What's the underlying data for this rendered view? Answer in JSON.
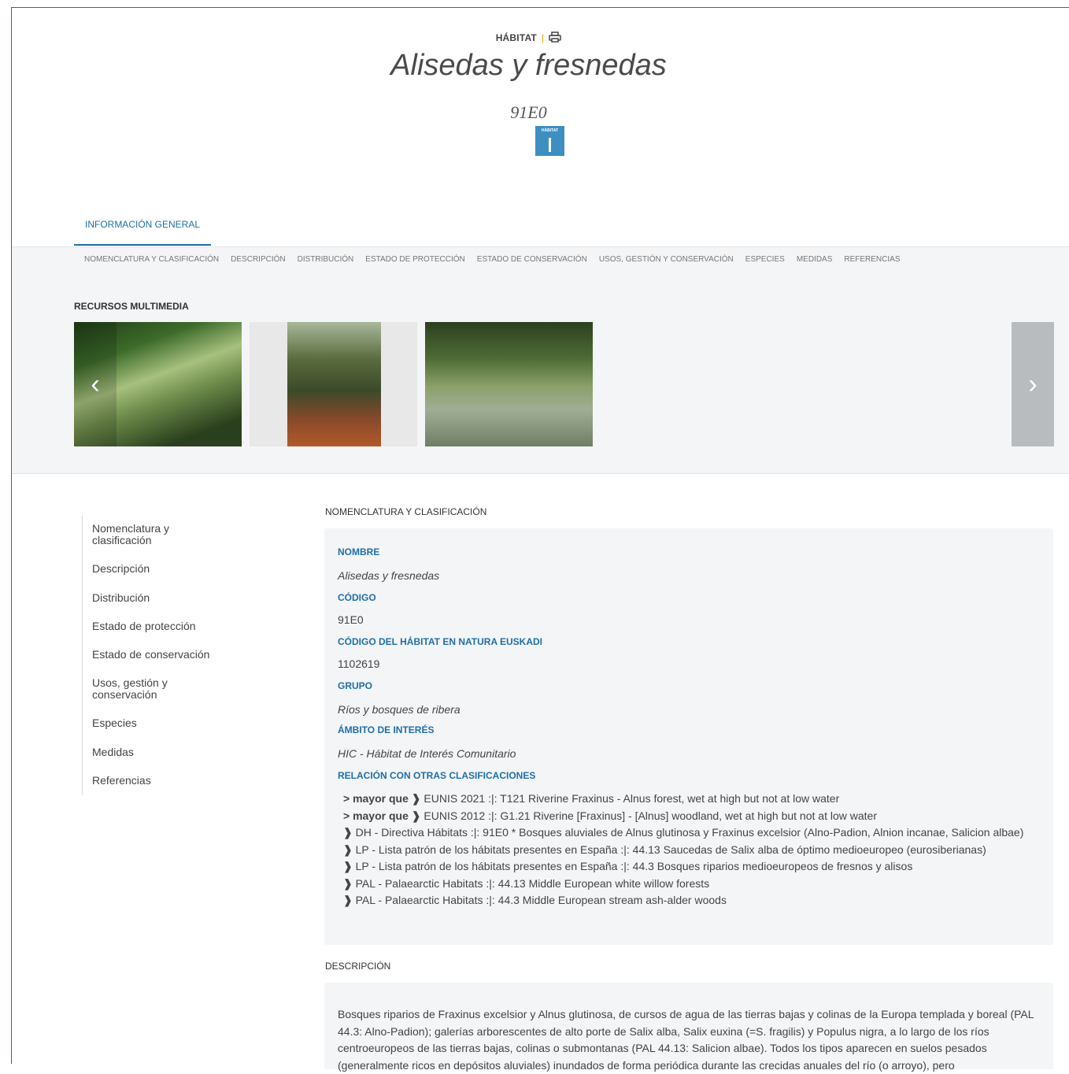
{
  "header": {
    "type_label": "HÁBITAT",
    "title": "Alisedas y fresnedas",
    "code": "91E0",
    "badge_label": "HÁBITAT"
  },
  "tabs": {
    "active": "INFORMACIÓN GENERAL"
  },
  "subnav": [
    "NOMENCLATURA Y CLASIFICACIÓN",
    "DESCRIPCIÓN",
    "DISTRIBUCIÓN",
    "ESTADO DE PROTECCIÓN",
    "ESTADO DE CONSERVACIÓN",
    "USOS, GESTIÓN Y CONSERVACIÓN",
    "ESPECIES",
    "MEDIDAS",
    "REFERENCIAS"
  ],
  "media": {
    "title": "RECURSOS MULTIMEDIA",
    "prev": "‹",
    "next": "›"
  },
  "sidenav": [
    "Nomenclatura y clasificación",
    "Descripción",
    "Distribución",
    "Estado de protección",
    "Estado de conservación",
    "Usos, gestión y conservación",
    "Especies",
    "Medidas",
    "Referencias"
  ],
  "nomenclatura": {
    "title": "NOMENCLATURA Y CLASIFICACIÓN",
    "nombre_label": "NOMBRE",
    "nombre": "Alisedas y fresnedas",
    "codigo_label": "CÓDIGO",
    "codigo": "91E0",
    "codigo_euskadi_label": "CÓDIGO DEL HÁBITAT EN NATURA EUSKADI",
    "codigo_euskadi": "1102619",
    "grupo_label": "GRUPO",
    "grupo": "Ríos y bosques de ribera",
    "ambito_label": "ÁMBITO DE INTERÉS",
    "ambito": "HIC - Hábitat de Interés Comunitario",
    "relacion_label": "RELACIÓN CON OTRAS CLASIFICACIONES",
    "relaciones": [
      {
        "prefix": "> mayor que ❱",
        "text": " EUNIS 2021 :|: T121 Riverine Fraxinus - Alnus forest, wet at high but not at low water"
      },
      {
        "prefix": "> mayor que ❱",
        "text": " EUNIS 2012 :|: G1.21 Riverine [Fraxinus] - [Alnus] woodland, wet at high but not at low water"
      },
      {
        "prefix": "❱",
        "text": " DH - Directiva Hábitats :|: 91E0 * Bosques aluviales de Alnus glutinosa y Fraxinus excelsior (Alno-Padion, Alnion incanae, Salicion albae)"
      },
      {
        "prefix": "❱",
        "text": " LP - Lista patrón de los hábitats presentes en España :|: 44.13 Saucedas de Salix alba de óptimo medioeuropeo (eurosiberianas)"
      },
      {
        "prefix": "❱",
        "text": " LP - Lista patrón de los hábitats presentes en España :|: 44.3 Bosques riparios medioeuropeos de fresnos y alisos"
      },
      {
        "prefix": "❱",
        "text": " PAL - Palaearctic Habitats :|: 44.13 Middle European white willow forests"
      },
      {
        "prefix": "❱",
        "text": " PAL - Palaearctic Habitats :|: 44.3 Middle European stream ash-alder woods"
      }
    ]
  },
  "descripcion": {
    "title": "DESCRIPCIÓN",
    "text": "Bosques riparios de Fraxinus excelsior y Alnus glutinosa, de cursos de agua de las tierras bajas y colinas de la Europa templada y boreal (PAL 44.3: Alno-Padion); galerías arborescentes de alto porte de Salix alba, Salix euxina (=S. fragilis) y Populus nigra, a lo largo de los ríos centroeuropeos de las tierras bajas, colinas o submontanas (PAL 44.13: Salicion albae). Todos los tipos aparecen en suelos pesados (generalmente ricos en depósitos aluviales) inundados de forma periódica durante las crecidas anuales del río (o arroyo), pero"
  }
}
